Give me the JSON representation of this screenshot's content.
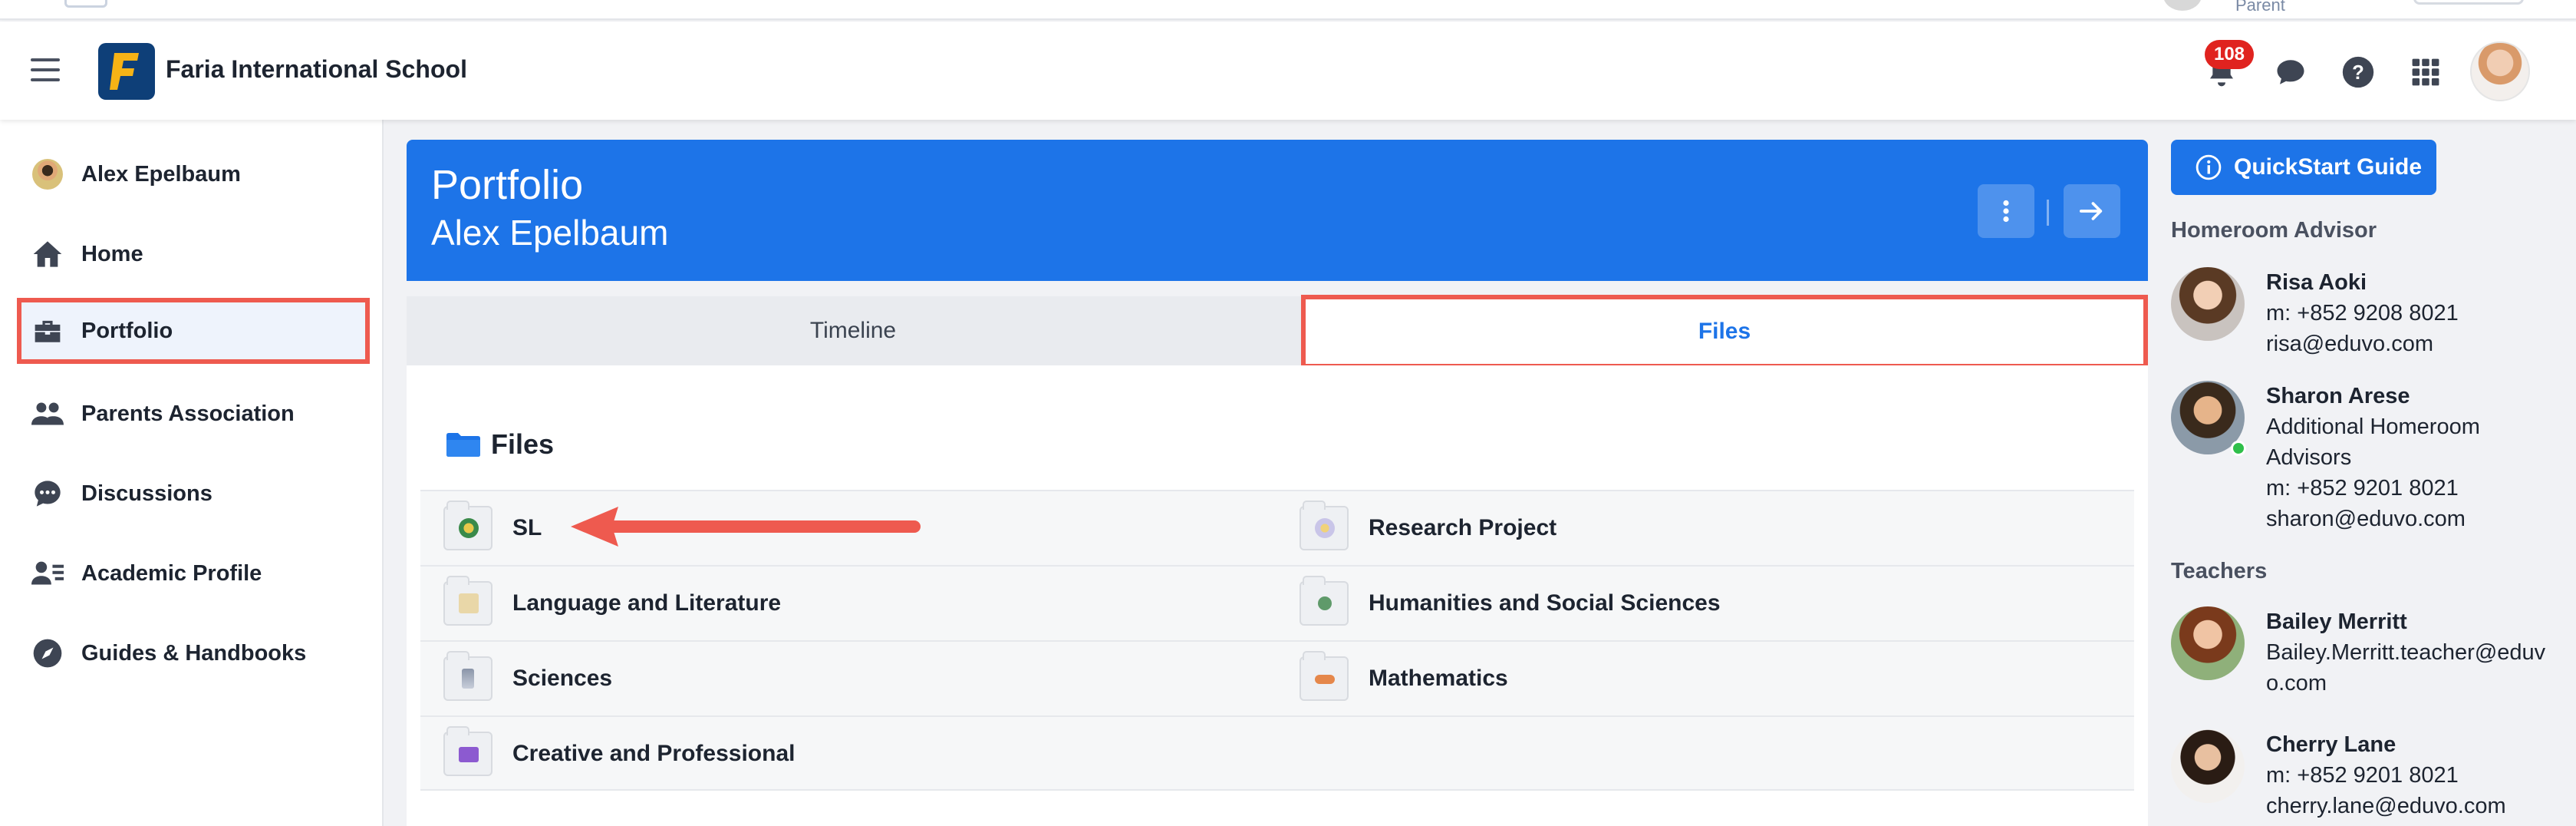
{
  "top_sliver": {
    "role": "Parent"
  },
  "header": {
    "school_name": "Faria International School",
    "notification_count": "108"
  },
  "sidebar": {
    "items": [
      {
        "label": "Alex Epelbaum",
        "icon": "user-avatar"
      },
      {
        "label": "Home",
        "icon": "home-icon"
      },
      {
        "label": "Portfolio",
        "icon": "briefcase-icon",
        "active": true
      },
      {
        "label": "Parents Association",
        "icon": "people-icon"
      },
      {
        "label": "Discussions",
        "icon": "chat-icon"
      },
      {
        "label": "Academic Profile",
        "icon": "profile-icon"
      },
      {
        "label": "Guides & Handbooks",
        "icon": "compass-icon"
      }
    ]
  },
  "main": {
    "banner": {
      "title": "Portfolio",
      "subtitle": "Alex Epelbaum"
    },
    "tabs": [
      {
        "label": "Timeline"
      },
      {
        "label": "Files",
        "active": true
      }
    ],
    "files_heading": "Files",
    "files": [
      [
        {
          "name": "SL"
        },
        {
          "name": "Research Project"
        }
      ],
      [
        {
          "name": "Language and Literature"
        },
        {
          "name": "Humanities and Social Sciences"
        }
      ],
      [
        {
          "name": "Sciences"
        },
        {
          "name": "Mathematics"
        }
      ],
      [
        {
          "name": "Creative and Professional"
        }
      ]
    ]
  },
  "right_panel": {
    "quickstart_label": "QuickStart Guide",
    "homeroom_title": "Homeroom Advisor",
    "advisors": [
      {
        "name": "Risa Aoki",
        "lines": [
          "m: +852 9208 8021",
          "risa@eduvo.com"
        ]
      },
      {
        "name": "Sharon Arese",
        "lines": [
          "Additional Homeroom",
          "Advisors",
          "m: +852 9201 8021",
          "sharon@eduvo.com"
        ]
      }
    ],
    "teachers_title": "Teachers",
    "teachers": [
      {
        "name": "Bailey Merritt",
        "lines": [
          "Bailey.Merritt.teacher@eduv",
          "o.com"
        ]
      },
      {
        "name": "Cherry Lane",
        "lines": [
          "m: +852 9201 8021",
          "cherry.lane@eduvo.com"
        ]
      }
    ]
  },
  "colors": {
    "accent": "#1d74e8",
    "highlight": "#ee5a4f",
    "badge": "#e0231f"
  }
}
